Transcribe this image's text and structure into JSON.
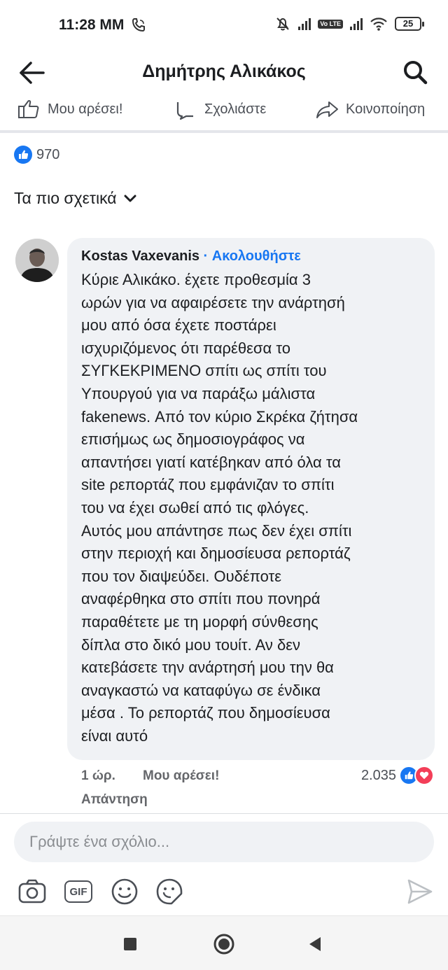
{
  "status": {
    "time": "11:28 MM",
    "volte_label": "Vo LTE",
    "battery": "25"
  },
  "header": {
    "title": "Δημήτρης Αλικάκος"
  },
  "actions": {
    "like": "Μου αρέσει!",
    "comment": "Σχολιάστε",
    "share": "Κοινοποίηση"
  },
  "reactions": {
    "count": "970"
  },
  "sort": {
    "label": "Τα πιο σχετικά"
  },
  "comment": {
    "author": "Kostas Vaxevanis",
    "separator": " · ",
    "follow": "Ακολουθήστε",
    "text": "Κύριε Αλικάκο. έχετε προθεσμία 3\nωρών για να αφαιρέσετε την ανάρτησή\nμου από όσα έχετε ποστάρει\nισχυριζόμενος ότι παρέθεσα το\nΣΥΓΚΕΚΡΙΜΕΝΟ σπίτι ως σπίτι του\nΥπουργού για να παράξω μάλιστα\nfakenews. Από τον κύριο Σκρέκα ζήτησα\nεπισήμως ως δημοσιογράφος να\nαπαντήσει γιατί κατέβηκαν από όλα τα\nsite  ρεπορτάζ που  εμφάνιζαν το σπίτι\nτου να έχει σωθεί από τις φλόγες.\nΑυτός μου απάντησε πως δεν έχει σπίτι\nστην περιοχή και δημοσίευσα ρεπορτάζ\nπου τον διαψεύδει. Ουδέποτε\nαναφέρθηκα στο σπίτι που πονηρά\nπαραθέτετε με τη μορφή σύνθεσης\nδίπλα στο δικό μου τουίτ. Αν δεν\nκατεβάσετε την ανάρτησή μου την  θα\nαναγκαστώ να καταφύγω σε ένδικα\nμέσα  . Το ρεπορτάζ που δημοσίευσα\nείναι αυτό",
    "time": "1 ώρ.",
    "like": "Μου αρέσει!",
    "reply": "Απάντηση",
    "reaction_count": "2.035"
  },
  "composer": {
    "placeholder": "Γράψτε ένα σχόλιο..."
  },
  "toolbar": {
    "gif_label": "GIF"
  },
  "colors": {
    "brand": "#1877f2",
    "bubble": "#f0f2f5",
    "heart": "#f33e58"
  }
}
